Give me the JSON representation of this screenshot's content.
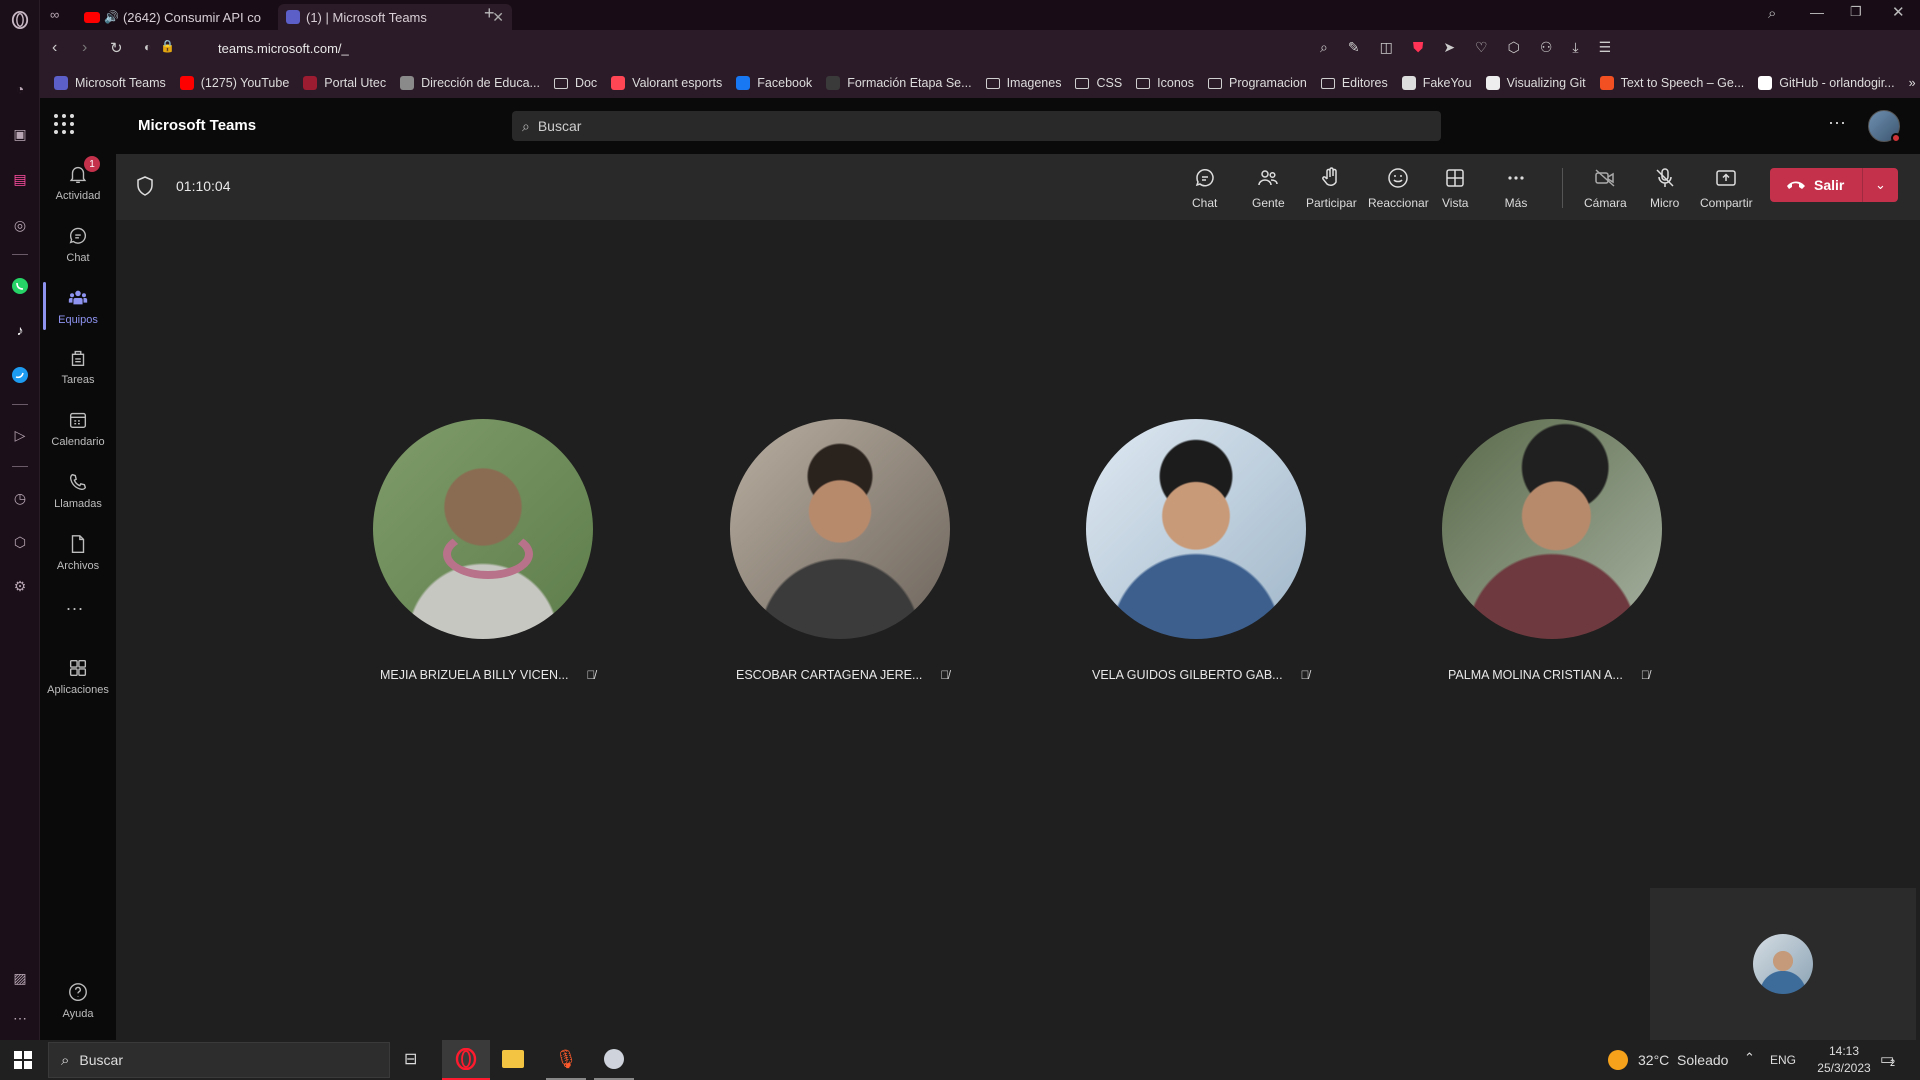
{
  "browser": {
    "tabs": [
      {
        "label": "(2642) Consumir API co",
        "active": false
      },
      {
        "label": "(1) | Microsoft Teams",
        "active": true
      }
    ],
    "new_tab": "+",
    "url": "teams.microsoft.com/_",
    "bookmarks": [
      {
        "label": "Microsoft Teams",
        "color": "#5b5fc7"
      },
      {
        "label": "(1275) YouTube",
        "color": "#ff0000"
      },
      {
        "label": "Portal Utec",
        "color": "#9b1b30"
      },
      {
        "label": "Dirección de Educa...",
        "color": "#8a8a8a"
      },
      {
        "label": "Doc",
        "color": "folder"
      },
      {
        "label": "Valorant esports",
        "color": "#ff4655"
      },
      {
        "label": "Facebook",
        "color": "#1877f2"
      },
      {
        "label": "Formación Etapa Se...",
        "color": "#3a3a3a"
      },
      {
        "label": "Imagenes",
        "color": "folder"
      },
      {
        "label": "CSS",
        "color": "folder"
      },
      {
        "label": "Iconos",
        "color": "folder"
      },
      {
        "label": "Programacion",
        "color": "folder"
      },
      {
        "label": "Editores",
        "color": "folder"
      },
      {
        "label": "FakeYou",
        "color": "#dddddd"
      },
      {
        "label": "Visualizing Git",
        "color": "#eeeeee"
      },
      {
        "label": "Text to Speech – Ge...",
        "color": "#f25022"
      },
      {
        "label": "GitHub - orlandogir...",
        "color": "#ffffff"
      }
    ]
  },
  "teams": {
    "app_title": "Microsoft Teams",
    "search_placeholder": "Buscar",
    "rail": [
      {
        "label": "Actividad",
        "icon": "bell-icon",
        "badge": "1"
      },
      {
        "label": "Chat",
        "icon": "chat-icon"
      },
      {
        "label": "Equipos",
        "icon": "teams-icon",
        "active": true
      },
      {
        "label": "Tareas",
        "icon": "tasks-icon"
      },
      {
        "label": "Calendario",
        "icon": "calendar-icon"
      },
      {
        "label": "Llamadas",
        "icon": "phone-icon"
      },
      {
        "label": "Archivos",
        "icon": "file-icon"
      },
      {
        "label": "Aplicaciones",
        "icon": "apps-icon"
      },
      {
        "label": "Ayuda",
        "icon": "help-icon"
      }
    ],
    "more": "...",
    "meeting": {
      "timer": "01:10:04",
      "toolbar": {
        "chat": "Chat",
        "people": "Gente",
        "raise": "Participar",
        "react": "Reaccionar",
        "view": "Vista",
        "more": "Más",
        "camera": "Cámara",
        "mic": "Micro",
        "share": "Compartir",
        "leave": "Salir"
      },
      "participants": [
        {
          "name": "MEJIA BRIZUELA BILLY VICEN...",
          "muted": true
        },
        {
          "name": "ESCOBAR CARTAGENA JERE...",
          "muted": true
        },
        {
          "name": "VELA GUIDOS GILBERTO GAB...",
          "muted": true
        },
        {
          "name": "PALMA MOLINA CRISTIAN A...",
          "muted": true
        }
      ]
    }
  },
  "taskbar": {
    "search": "Buscar",
    "weather": "32°C  Soleado",
    "lang": "ENG",
    "time": "14:13",
    "date": "25/3/2023",
    "notif_count": "2"
  },
  "colors": {
    "accent": "#8e93f0",
    "leave": "#c4314b",
    "opera": "#ff1b2d"
  }
}
